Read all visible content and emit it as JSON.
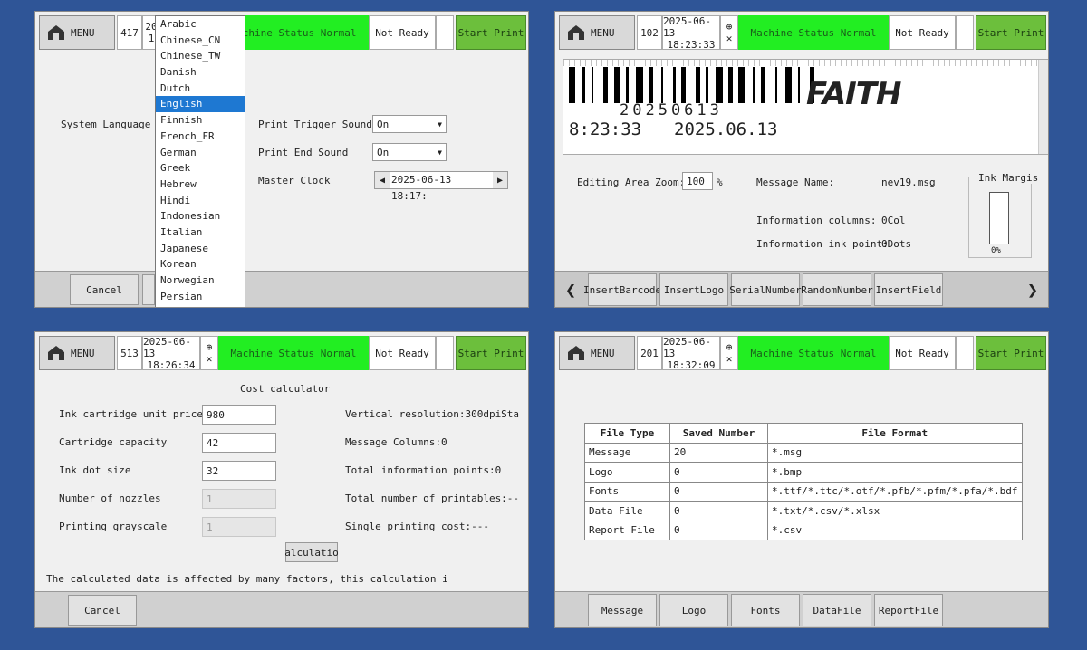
{
  "colors": {
    "background": "#2f5597",
    "status_green": "#22ee22",
    "start_green": "#6cbf3c",
    "selected_blue": "#1e78d2"
  },
  "header": {
    "menu_label": "MENU",
    "status": "Machine Status Normal",
    "ready": "Not Ready",
    "start": "Start Print",
    "globe_icon": "globe-icon",
    "close_mark": "✕"
  },
  "p1": {
    "count": "417",
    "date_partial": "20",
    "time_partial": "1",
    "system_language_label": "System Language",
    "languages": [
      "Arabic",
      "Chinese_CN",
      "Chinese_TW",
      "Danish",
      "Dutch",
      "English",
      "Finnish",
      "French_FR",
      "German",
      "Greek",
      "Hebrew",
      "Hindi",
      "Indonesian",
      "Italian",
      "Japanese",
      "Korean",
      "Norwegian",
      "Persian"
    ],
    "selected_language": "English",
    "trigger_label": "Print Trigger Sound",
    "trigger_value": "On",
    "end_label": "Print End Sound",
    "end_value": "On",
    "clock_label": "Master Clock",
    "clock_value": "2025-06-13 18:17:",
    "cancel": "Cancel"
  },
  "p2": {
    "count": "102",
    "date": "2025-06-13",
    "time": "18:23:33",
    "barcode_text": "20250613",
    "time_text": "8:23:33",
    "date_text": "2025.06.13",
    "logo_text": "FAITH",
    "zoom_label": "Editing Area Zoom:",
    "zoom_value": "100",
    "zoom_unit": "%",
    "msg_name_label": "Message Name:",
    "msg_name_value": "nev19.msg",
    "info_cols_label": "Information columns:",
    "info_cols_value": "0Col",
    "info_ink_label": "Information ink point:",
    "info_ink_value": "0Dots",
    "ink_margin_label": "Ink Margis",
    "ink_percent": "0%",
    "ink_fraction": 0.0,
    "buttons": [
      {
        "l1": "Insert",
        "l2": "Barcode"
      },
      {
        "l1": "Insert",
        "l2": "Logo"
      },
      {
        "l1": "Serial",
        "l2": "Number"
      },
      {
        "l1": "Random",
        "l2": "Number"
      },
      {
        "l1": "Insert",
        "l2": "Field"
      }
    ],
    "prev_arrow": "❮",
    "next_arrow": "❯"
  },
  "p3": {
    "count": "513",
    "date": "2025-06-13",
    "time": "18:26:34",
    "title": "Cost calculator",
    "fields": [
      {
        "label": "Ink cartridge unit price",
        "value": "980",
        "disabled": false
      },
      {
        "label": "Cartridge capacity",
        "value": "42",
        "disabled": false
      },
      {
        "label": "Ink dot size",
        "value": "32",
        "disabled": false
      },
      {
        "label": "Number of nozzles",
        "value": "1",
        "disabled": true
      },
      {
        "label": "Printing grayscale",
        "value": "1",
        "disabled": true
      }
    ],
    "right": [
      "Vertical resolution:300dpiSta",
      "Message Columns:0",
      "Total information points:0",
      "Total number of printables:--",
      "Single printing cost:---"
    ],
    "calc_button": "alculatio",
    "note": "The calculated data is affected by many factors, this calculation i",
    "cancel": "Cancel"
  },
  "p4": {
    "count": "201",
    "date": "2025-06-13",
    "time": "18:32:09",
    "headers": [
      "File Type",
      "Saved Number",
      "File Format"
    ],
    "rows": [
      [
        "Message",
        "20",
        "*.msg"
      ],
      [
        "Logo",
        "0",
        "*.bmp"
      ],
      [
        "Fonts",
        "0",
        "*.ttf/*.ttc/*.otf/*.pfb/*.pfm/*.pfa/*.bdf"
      ],
      [
        "Data File",
        "0",
        "*.txt/*.csv/*.xlsx"
      ],
      [
        "Report File",
        "0",
        "*.csv"
      ]
    ],
    "tabs": [
      {
        "l1": "Message",
        "l2": ""
      },
      {
        "l1": "Logo",
        "l2": ""
      },
      {
        "l1": "Fonts",
        "l2": ""
      },
      {
        "l1": "Data",
        "l2": "File"
      },
      {
        "l1": "Report",
        "l2": "File"
      }
    ]
  }
}
